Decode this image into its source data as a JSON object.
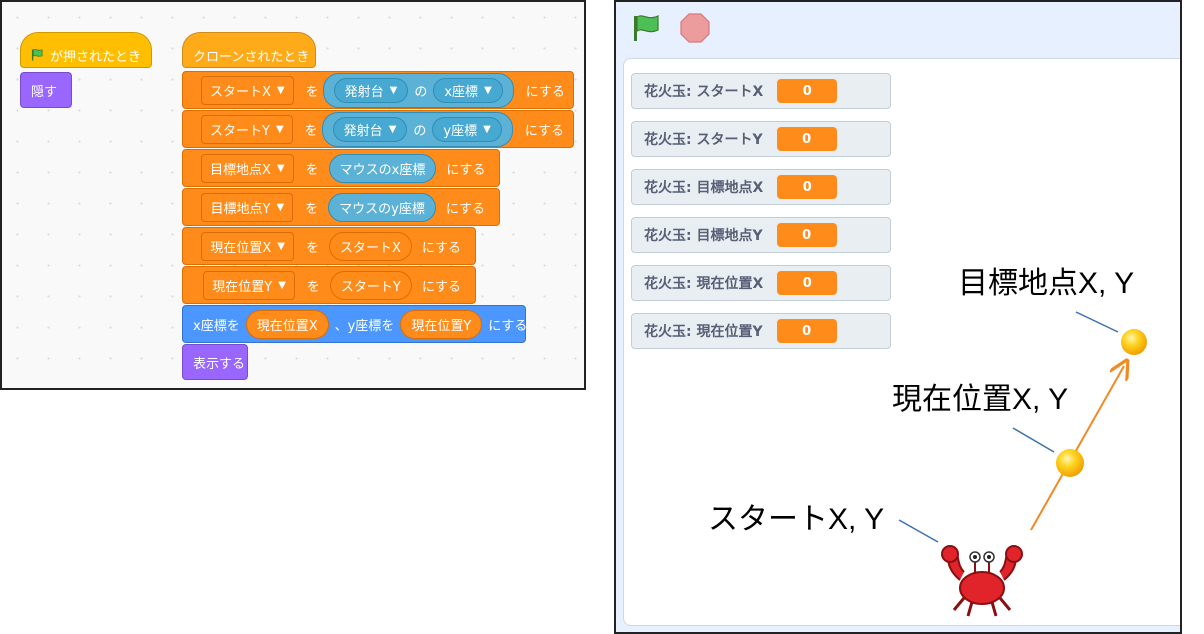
{
  "code": {
    "green_flag_hat": "が押されたとき",
    "hide_block": "隠す",
    "clone_hat": "クローンされたとき",
    "set_blocks": [
      {
        "var": "スタートX",
        "wo": "を",
        "sensing": {
          "object": "発射台",
          "no": "の",
          "prop": "x座標"
        },
        "suffix": "にする"
      },
      {
        "var": "スタートY",
        "wo": "を",
        "sensing": {
          "object": "発射台",
          "no": "の",
          "prop": "y座標"
        },
        "suffix": "にする"
      },
      {
        "var": "目標地点X",
        "wo": "を",
        "reporter": "マウスのx座標",
        "suffix": "にする"
      },
      {
        "var": "目標地点Y",
        "wo": "を",
        "reporter": "マウスのy座標",
        "suffix": "にする"
      },
      {
        "var": "現在位置X",
        "wo": "を",
        "reporter": "スタートX",
        "suffix": "にする"
      },
      {
        "var": "現在位置Y",
        "wo": "を",
        "reporter": "スタートY",
        "suffix": "にする"
      }
    ],
    "goto": {
      "prefix": "x座標を",
      "x": "現在位置X",
      "mid": "、y座標を",
      "y": "現在位置Y",
      "suffix": "にする"
    },
    "show_block": "表示する"
  },
  "stage": {
    "monitors": [
      {
        "label": "花火玉: スタートX",
        "value": "0"
      },
      {
        "label": "花火玉: スタートY",
        "value": "0"
      },
      {
        "label": "花火玉: 目標地点X",
        "value": "0"
      },
      {
        "label": "花火玉: 目標地点Y",
        "value": "0"
      },
      {
        "label": "花火玉: 現在位置X",
        "value": "0"
      },
      {
        "label": "花火玉: 現在位置Y",
        "value": "0"
      }
    ],
    "annotations": {
      "target": "目標地点X, Y",
      "current": "現在位置X, Y",
      "start": "スタートX, Y"
    }
  },
  "colors": {
    "events": "#ffbf00",
    "looks": "#9966ff",
    "data": "#ff8c1a",
    "motion": "#4c97ff",
    "sensing": "#5cb1d6"
  }
}
